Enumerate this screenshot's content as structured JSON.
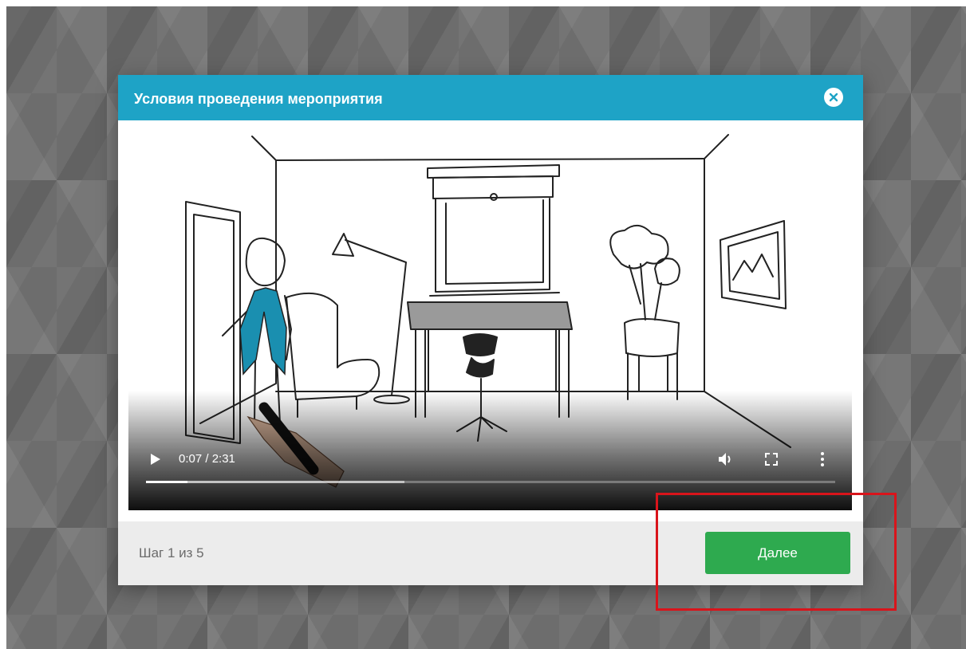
{
  "modal": {
    "title": "Условия проведения мероприятия"
  },
  "video": {
    "time": "0:07 / 2:31",
    "progress_played": 0.06,
    "progress_buffered": 0.375,
    "icons": [
      "play-icon",
      "volume-icon",
      "fullscreen-icon",
      "more-vert-icon"
    ]
  },
  "footer": {
    "step": "Шаг 1 из 5",
    "next_label": "Далее"
  },
  "colors": {
    "header": "#1ea3c6",
    "next_button": "#2eaa4f",
    "highlight": "#d9141b",
    "accent_figure": "#1a8fb0"
  }
}
